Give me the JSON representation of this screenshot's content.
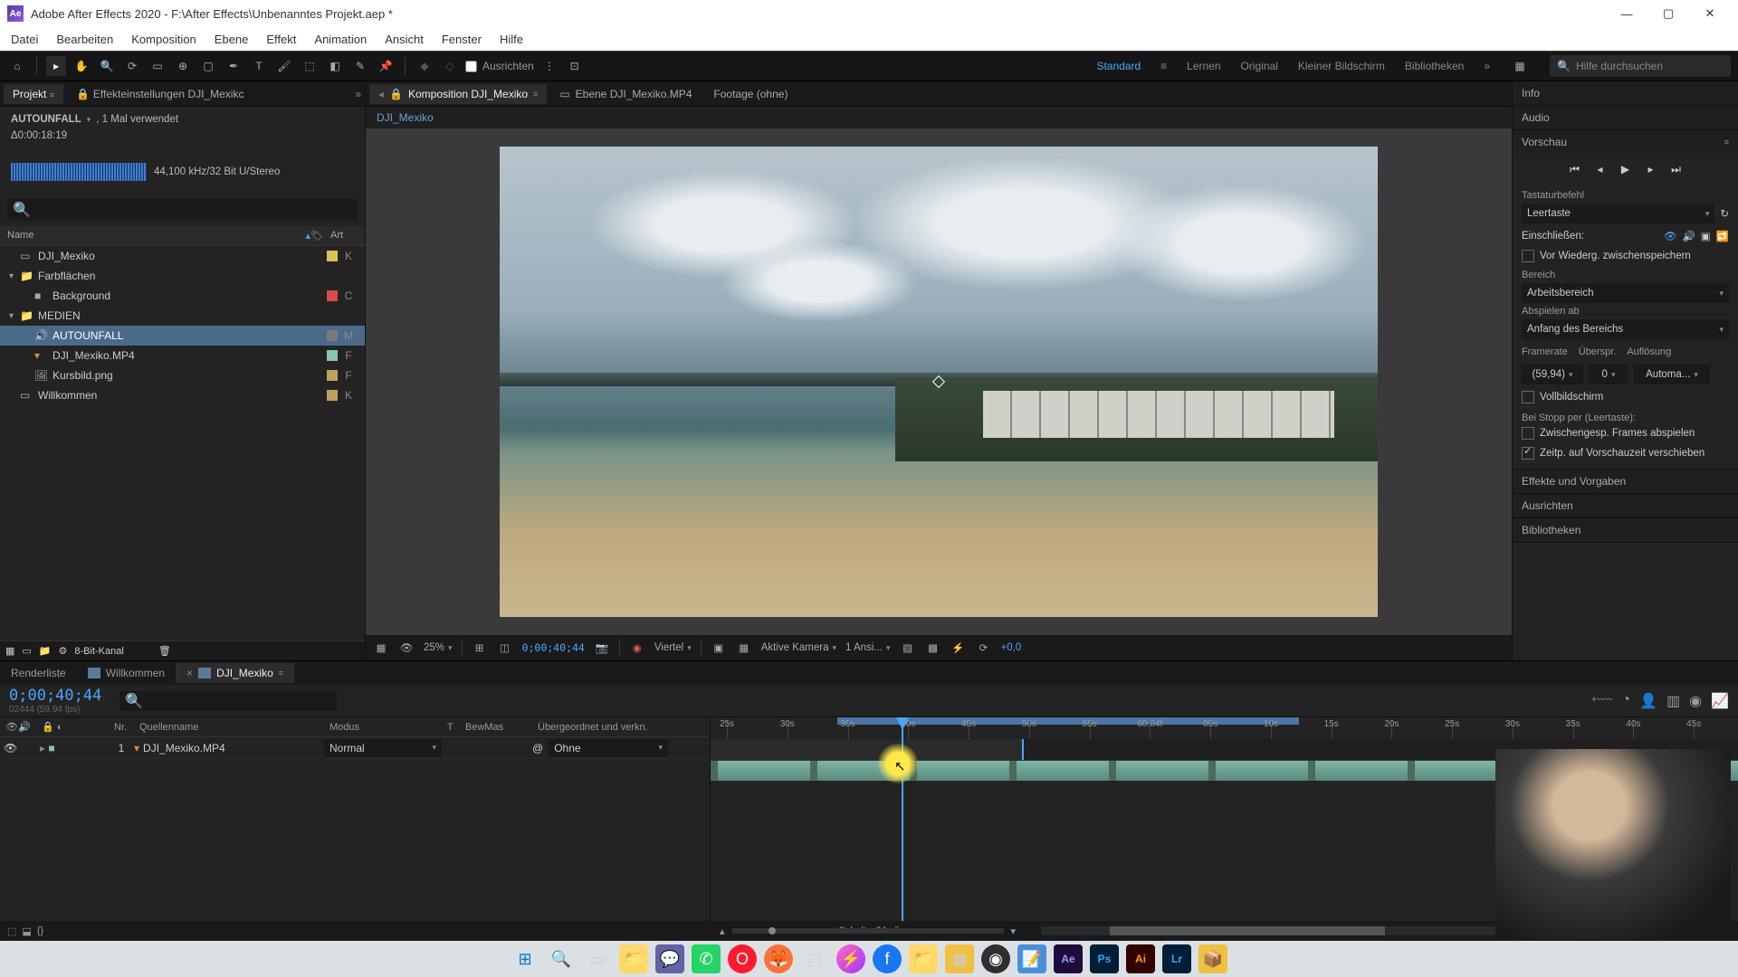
{
  "titlebar": {
    "text": "Adobe After Effects 2020 - F:\\After Effects\\Unbenanntes Projekt.aep *"
  },
  "menu": [
    "Datei",
    "Bearbeiten",
    "Komposition",
    "Ebene",
    "Effekt",
    "Animation",
    "Ansicht",
    "Fenster",
    "Hilfe"
  ],
  "toolbar": {
    "snap_label": "Ausrichten",
    "workspaces": [
      "Standard",
      "Lernen",
      "Original",
      "Kleiner Bildschirm",
      "Bibliotheken"
    ],
    "active_ws": "Standard",
    "search_ph": "Hilfe durchsuchen"
  },
  "project": {
    "tab_proj": "Projekt",
    "tab_effects": "Effekteinstellungen  DJI_Mexikc",
    "asset_name": "AUTOUNFALL",
    "asset_meta": ", 1 Mal verwendet",
    "duration": "Δ0:00:18:19",
    "audio_meta": "44,100 kHz/32 Bit U/Stereo",
    "cols": {
      "name": "Name",
      "art": "Art"
    },
    "items": [
      {
        "indent": 0,
        "tw": "",
        "icon": "comp",
        "label": "DJI_Mexiko",
        "sw": "#d9c25a",
        "art": "K"
      },
      {
        "indent": 0,
        "tw": "▾",
        "icon": "folder",
        "label": "Farbflächen",
        "sw": "",
        "art": ""
      },
      {
        "indent": 1,
        "tw": "",
        "icon": "solid",
        "label": "Background",
        "sw": "#d94a4a",
        "art": "C"
      },
      {
        "indent": 0,
        "tw": "▾",
        "icon": "folder",
        "label": "MEDIEN",
        "sw": "",
        "art": ""
      },
      {
        "indent": 1,
        "tw": "",
        "icon": "audio",
        "label": "AUTOUNFALL",
        "sw": "#7a7a7a",
        "art": "M",
        "sel": true
      },
      {
        "indent": 1,
        "tw": "",
        "icon": "video",
        "label": "DJI_Mexiko.MP4",
        "sw": "#8ac6a8",
        "art": "F"
      },
      {
        "indent": 1,
        "tw": "",
        "icon": "image",
        "label": "Kursbild.png",
        "sw": "#c0a060",
        "art": "F"
      },
      {
        "indent": 0,
        "tw": "",
        "icon": "comp",
        "label": "Willkommen",
        "sw": "#c0a060",
        "art": "K"
      }
    ],
    "bit_depth": "8-Bit-Kanal"
  },
  "comp": {
    "tabs": [
      {
        "label": "Komposition  DJI_Mexiko",
        "active": true,
        "closable": true,
        "icon": "comp"
      },
      {
        "label": "Ebene  DJI_Mexiko.MP4",
        "active": false,
        "closable": false,
        "icon": "layer"
      },
      {
        "label": "Footage  (ohne)",
        "active": false,
        "closable": false,
        "icon": ""
      }
    ],
    "breadcrumb": "DJI_Mexiko",
    "zoom": "25%",
    "timecode": "0;00;40;44",
    "resolution": "Viertel",
    "camera": "Aktive Kamera",
    "views": "1 Ansi...",
    "exposure": "+0,0"
  },
  "right": {
    "info": "Info",
    "audio": "Audio",
    "preview": "Vorschau",
    "shortcut_lbl": "Tastaturbefehl",
    "shortcut_val": "Leertaste",
    "include_lbl": "Einschließen:",
    "cache_lbl": "Vor Wiederg. zwischenspeichern",
    "range_lbl": "Bereich",
    "range_val": "Arbeitsbereich",
    "playfrom_lbl": "Abspielen ab",
    "playfrom_val": "Anfang des Bereichs",
    "framerate_lbl": "Framerate",
    "skip_lbl": "Überspr.",
    "res_lbl": "Auflösung",
    "framerate_val": "(59,94)",
    "skip_val": "0",
    "res_val": "Automa...",
    "fullscreen_lbl": "Vollbildschirm",
    "stop_lbl": "Bei Stopp per (Leertaste):",
    "cached_lbl": "Zwischengesp. Frames abspielen",
    "move_lbl": "Zeitp. auf Vorschauzeit verschieben",
    "effects": "Effekte und Vorgaben",
    "align": "Ausrichten",
    "libs": "Bibliotheken"
  },
  "timeline": {
    "tabs": [
      {
        "label": "Renderliste",
        "active": false
      },
      {
        "label": "Willkommen",
        "active": false,
        "icon": true
      },
      {
        "label": "DJI_Mexiko",
        "active": true,
        "icon": true,
        "closable": true
      }
    ],
    "time": "0;00;40;44",
    "frames_fps": "02444 (59.94 fps)",
    "cols": {
      "nr": "Nr.",
      "source": "Quellenname",
      "mode": "Modus",
      "t": "T",
      "bw": "BewMas",
      "parent": "Übergeordnet und verkn."
    },
    "layer": {
      "nr": "1",
      "name": "DJI_Mexiko.MP4",
      "mode": "Normal",
      "parent": "Ohne"
    },
    "ticks": [
      "25s",
      "30s",
      "35s",
      "40s",
      "45s",
      "50s",
      "55s",
      "00:04f",
      "05s",
      "10s",
      "15s",
      "20s",
      "25s",
      "30s",
      "35s",
      "40s",
      "45s"
    ],
    "footer": "Schalter/Modi"
  },
  "taskbar_icons": [
    "windows",
    "search",
    "tasks",
    "explorer",
    "teams",
    "whatsapp",
    "opera",
    "firefox",
    "app1",
    "messenger",
    "facebook",
    "folder",
    "app2",
    "obs",
    "notes",
    "ae",
    "ps",
    "ai",
    "lr",
    "app3"
  ]
}
